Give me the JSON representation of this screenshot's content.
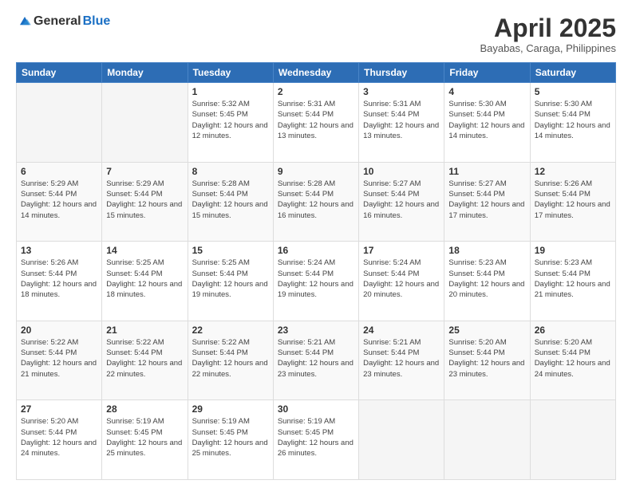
{
  "header": {
    "logo_general": "General",
    "logo_blue": "Blue",
    "title": "April 2025",
    "location": "Bayabas, Caraga, Philippines"
  },
  "days_of_week": [
    "Sunday",
    "Monday",
    "Tuesday",
    "Wednesday",
    "Thursday",
    "Friday",
    "Saturday"
  ],
  "weeks": [
    [
      {
        "day": "",
        "sunrise": "",
        "sunset": "",
        "daylight": ""
      },
      {
        "day": "",
        "sunrise": "",
        "sunset": "",
        "daylight": ""
      },
      {
        "day": "1",
        "sunrise": "Sunrise: 5:32 AM",
        "sunset": "Sunset: 5:45 PM",
        "daylight": "Daylight: 12 hours and 12 minutes."
      },
      {
        "day": "2",
        "sunrise": "Sunrise: 5:31 AM",
        "sunset": "Sunset: 5:44 PM",
        "daylight": "Daylight: 12 hours and 13 minutes."
      },
      {
        "day": "3",
        "sunrise": "Sunrise: 5:31 AM",
        "sunset": "Sunset: 5:44 PM",
        "daylight": "Daylight: 12 hours and 13 minutes."
      },
      {
        "day": "4",
        "sunrise": "Sunrise: 5:30 AM",
        "sunset": "Sunset: 5:44 PM",
        "daylight": "Daylight: 12 hours and 14 minutes."
      },
      {
        "day": "5",
        "sunrise": "Sunrise: 5:30 AM",
        "sunset": "Sunset: 5:44 PM",
        "daylight": "Daylight: 12 hours and 14 minutes."
      }
    ],
    [
      {
        "day": "6",
        "sunrise": "Sunrise: 5:29 AM",
        "sunset": "Sunset: 5:44 PM",
        "daylight": "Daylight: 12 hours and 14 minutes."
      },
      {
        "day": "7",
        "sunrise": "Sunrise: 5:29 AM",
        "sunset": "Sunset: 5:44 PM",
        "daylight": "Daylight: 12 hours and 15 minutes."
      },
      {
        "day": "8",
        "sunrise": "Sunrise: 5:28 AM",
        "sunset": "Sunset: 5:44 PM",
        "daylight": "Daylight: 12 hours and 15 minutes."
      },
      {
        "day": "9",
        "sunrise": "Sunrise: 5:28 AM",
        "sunset": "Sunset: 5:44 PM",
        "daylight": "Daylight: 12 hours and 16 minutes."
      },
      {
        "day": "10",
        "sunrise": "Sunrise: 5:27 AM",
        "sunset": "Sunset: 5:44 PM",
        "daylight": "Daylight: 12 hours and 16 minutes."
      },
      {
        "day": "11",
        "sunrise": "Sunrise: 5:27 AM",
        "sunset": "Sunset: 5:44 PM",
        "daylight": "Daylight: 12 hours and 17 minutes."
      },
      {
        "day": "12",
        "sunrise": "Sunrise: 5:26 AM",
        "sunset": "Sunset: 5:44 PM",
        "daylight": "Daylight: 12 hours and 17 minutes."
      }
    ],
    [
      {
        "day": "13",
        "sunrise": "Sunrise: 5:26 AM",
        "sunset": "Sunset: 5:44 PM",
        "daylight": "Daylight: 12 hours and 18 minutes."
      },
      {
        "day": "14",
        "sunrise": "Sunrise: 5:25 AM",
        "sunset": "Sunset: 5:44 PM",
        "daylight": "Daylight: 12 hours and 18 minutes."
      },
      {
        "day": "15",
        "sunrise": "Sunrise: 5:25 AM",
        "sunset": "Sunset: 5:44 PM",
        "daylight": "Daylight: 12 hours and 19 minutes."
      },
      {
        "day": "16",
        "sunrise": "Sunrise: 5:24 AM",
        "sunset": "Sunset: 5:44 PM",
        "daylight": "Daylight: 12 hours and 19 minutes."
      },
      {
        "day": "17",
        "sunrise": "Sunrise: 5:24 AM",
        "sunset": "Sunset: 5:44 PM",
        "daylight": "Daylight: 12 hours and 20 minutes."
      },
      {
        "day": "18",
        "sunrise": "Sunrise: 5:23 AM",
        "sunset": "Sunset: 5:44 PM",
        "daylight": "Daylight: 12 hours and 20 minutes."
      },
      {
        "day": "19",
        "sunrise": "Sunrise: 5:23 AM",
        "sunset": "Sunset: 5:44 PM",
        "daylight": "Daylight: 12 hours and 21 minutes."
      }
    ],
    [
      {
        "day": "20",
        "sunrise": "Sunrise: 5:22 AM",
        "sunset": "Sunset: 5:44 PM",
        "daylight": "Daylight: 12 hours and 21 minutes."
      },
      {
        "day": "21",
        "sunrise": "Sunrise: 5:22 AM",
        "sunset": "Sunset: 5:44 PM",
        "daylight": "Daylight: 12 hours and 22 minutes."
      },
      {
        "day": "22",
        "sunrise": "Sunrise: 5:22 AM",
        "sunset": "Sunset: 5:44 PM",
        "daylight": "Daylight: 12 hours and 22 minutes."
      },
      {
        "day": "23",
        "sunrise": "Sunrise: 5:21 AM",
        "sunset": "Sunset: 5:44 PM",
        "daylight": "Daylight: 12 hours and 23 minutes."
      },
      {
        "day": "24",
        "sunrise": "Sunrise: 5:21 AM",
        "sunset": "Sunset: 5:44 PM",
        "daylight": "Daylight: 12 hours and 23 minutes."
      },
      {
        "day": "25",
        "sunrise": "Sunrise: 5:20 AM",
        "sunset": "Sunset: 5:44 PM",
        "daylight": "Daylight: 12 hours and 23 minutes."
      },
      {
        "day": "26",
        "sunrise": "Sunrise: 5:20 AM",
        "sunset": "Sunset: 5:44 PM",
        "daylight": "Daylight: 12 hours and 24 minutes."
      }
    ],
    [
      {
        "day": "27",
        "sunrise": "Sunrise: 5:20 AM",
        "sunset": "Sunset: 5:44 PM",
        "daylight": "Daylight: 12 hours and 24 minutes."
      },
      {
        "day": "28",
        "sunrise": "Sunrise: 5:19 AM",
        "sunset": "Sunset: 5:45 PM",
        "daylight": "Daylight: 12 hours and 25 minutes."
      },
      {
        "day": "29",
        "sunrise": "Sunrise: 5:19 AM",
        "sunset": "Sunset: 5:45 PM",
        "daylight": "Daylight: 12 hours and 25 minutes."
      },
      {
        "day": "30",
        "sunrise": "Sunrise: 5:19 AM",
        "sunset": "Sunset: 5:45 PM",
        "daylight": "Daylight: 12 hours and 26 minutes."
      },
      {
        "day": "",
        "sunrise": "",
        "sunset": "",
        "daylight": ""
      },
      {
        "day": "",
        "sunrise": "",
        "sunset": "",
        "daylight": ""
      },
      {
        "day": "",
        "sunrise": "",
        "sunset": "",
        "daylight": ""
      }
    ]
  ]
}
